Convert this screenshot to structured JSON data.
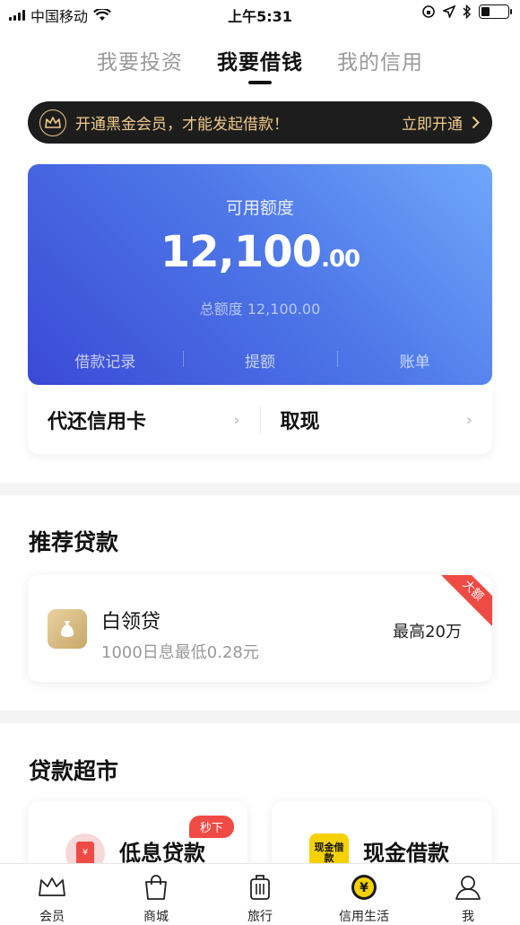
{
  "status_bar": {
    "carrier": "中国移动",
    "time": "上午5:31"
  },
  "tabs": [
    {
      "label": "我要投资",
      "active": false
    },
    {
      "label": "我要借钱",
      "active": true
    },
    {
      "label": "我的信用",
      "active": false
    }
  ],
  "vip_banner": {
    "text": "开通黑金会员，才能发起借款！",
    "cta": "立即开通"
  },
  "credit": {
    "label": "可用额度",
    "amount_int": "12,100",
    "amount_dec": ".00",
    "total": "总额度 12,100.00",
    "links": [
      "借款记录",
      "提额",
      "账单"
    ]
  },
  "quick_actions": [
    "代还信用卡",
    "取现"
  ],
  "recommend": {
    "title": "推荐贷款",
    "item": {
      "name": "白领贷",
      "desc": "1000日息最低0.28元",
      "max": "最高20万",
      "ribbon": "大额"
    }
  },
  "market": {
    "title": "贷款超市",
    "items": [
      {
        "name": "低息贷款",
        "badge": "秒下",
        "icon_text": "¥"
      },
      {
        "name": "现金借款",
        "icon_text": "现金借款"
      }
    ]
  },
  "bottom_nav": [
    "会员",
    "商城",
    "旅行",
    "信用生活",
    "我"
  ],
  "colors": {
    "brand_blue": "#4e78e8",
    "gold": "#f0c98a",
    "red": "#f04a44",
    "yellow": "#f5d100"
  }
}
